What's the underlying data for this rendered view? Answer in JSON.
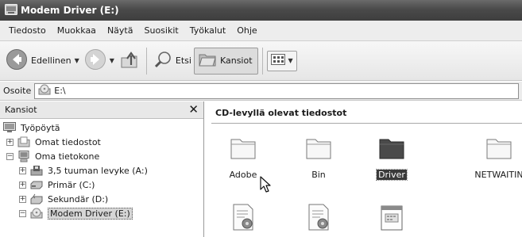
{
  "window": {
    "title": "Modem Driver (E:)"
  },
  "menubar": {
    "items": [
      "Tiedosto",
      "Muokkaa",
      "Näytä",
      "Suosikit",
      "Työkalut",
      "Ohje"
    ]
  },
  "toolbar": {
    "back_label": "Edellinen",
    "search_label": "Etsi",
    "folders_label": "Kansiot"
  },
  "addressbar": {
    "label": "Osoite",
    "value": "E:\\"
  },
  "folders_pane": {
    "header": "Kansiot",
    "close_glyph": "✕",
    "tree": [
      {
        "label": "Työpöytä",
        "icon": "desktop-icon"
      },
      {
        "label": "Omat tiedostot",
        "icon": "documents-folder-icon",
        "expander": "+"
      },
      {
        "label": "Oma tietokone",
        "icon": "computer-icon",
        "expander": "−"
      },
      {
        "label": "3,5 tuuman levyke (A:)",
        "icon": "floppy-drive-icon",
        "expander": "+"
      },
      {
        "label": "Primär (C:)",
        "icon": "hard-drive-icon",
        "expander": "+"
      },
      {
        "label": "Sekundär (D:)",
        "icon": "hard-drive-icon",
        "expander": "+"
      },
      {
        "label": "Modem Driver (E:)",
        "icon": "cd-drive-icon",
        "expander": "−",
        "selected": true
      }
    ]
  },
  "content": {
    "heading": "CD-levyllä olevat tiedostot",
    "files": [
      {
        "name": "Adobe",
        "icon": "folder-icon"
      },
      {
        "name": "Bin",
        "icon": "folder-icon"
      },
      {
        "name": "Driver",
        "icon": "folder-icon",
        "selected": true
      },
      {
        "name": "NETWAITIN",
        "icon": "folder-icon"
      },
      {
        "name": "",
        "icon": "setup-document-icon"
      },
      {
        "name": "",
        "icon": "setup-document-icon"
      },
      {
        "name": "",
        "icon": "application-window-icon"
      }
    ]
  },
  "colors": {
    "titlebar": "#4a4a4a",
    "selection": "#3a3a3a",
    "background": "#ffffff"
  }
}
